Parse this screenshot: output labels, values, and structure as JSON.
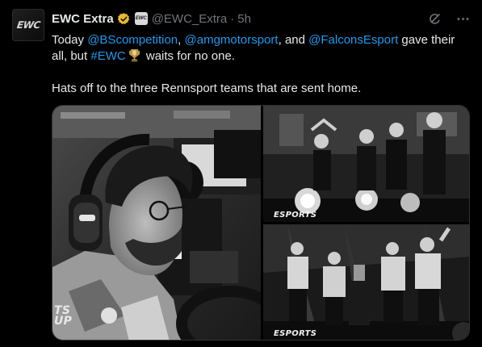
{
  "author": {
    "name": "EWC Extra",
    "handle": "@EWC_Extra",
    "separator": "·",
    "time": "5h",
    "avatar_text": "EWC"
  },
  "icons": {
    "verified": "verified-badge-icon",
    "affiliate": "affiliate-badge-icon",
    "grok": "grok-icon",
    "more": "more-icon",
    "trophy": "trophy-icon"
  },
  "tweet": {
    "line1": {
      "t0": "Today ",
      "m1": "@BScompetition",
      "t1": ", ",
      "m2": "@amgmotorsport",
      "t2": ", and ",
      "m3": "@FalconsEsport",
      "t3": " gave their all, but ",
      "hashtag": "#EWC",
      "t4": " waits for no one."
    },
    "line2": "Hats off to the three Rennsport teams that are sent home."
  },
  "media": {
    "watermark_top": "ESPORTS",
    "watermark_bottom": "ESPORTS",
    "side_text_1": "TS",
    "side_text_2": "UP"
  },
  "colors": {
    "background": "#000000",
    "text": "#e7e9ea",
    "muted": "#71767b",
    "link": "#1d9bf0",
    "verified_gold": "#e8b931"
  }
}
